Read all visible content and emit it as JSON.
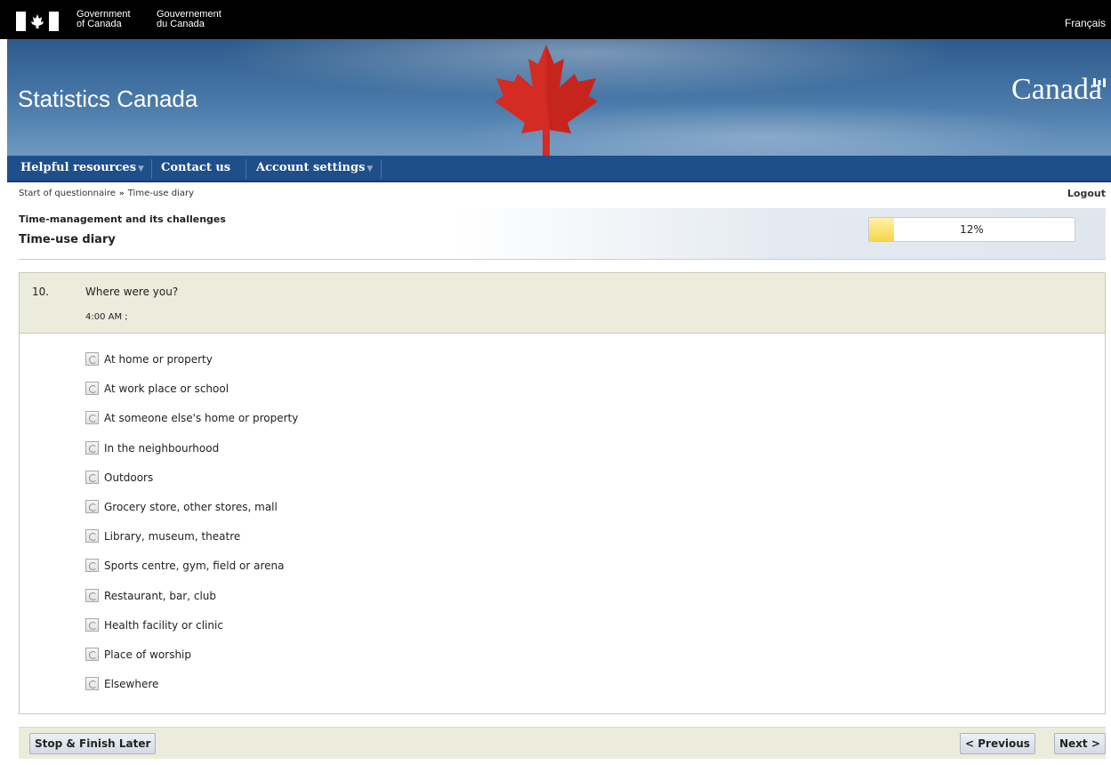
{
  "gov_bar": {
    "english_line1": "Government",
    "english_line2": "of Canada",
    "french_line1": "Gouvernement",
    "french_line2": "du Canada",
    "language_link": "Français"
  },
  "banner": {
    "site_title": "Statistics Canada",
    "wordmark": "Canada"
  },
  "nav": {
    "items": [
      {
        "label": "Helpful resources",
        "has_menu": true
      },
      {
        "label": "Contact us",
        "has_menu": false
      },
      {
        "label": "Account settings",
        "has_menu": true
      }
    ]
  },
  "breadcrumb": {
    "items": [
      "Start of questionnaire",
      "Time-use diary"
    ],
    "separator": "»"
  },
  "logout_label": "Logout",
  "section": {
    "subtitle": "Time-management and its challenges",
    "title": "Time-use diary"
  },
  "progress": {
    "percent": 12,
    "label": "12%"
  },
  "question": {
    "number": "10.",
    "text": "Where were you?",
    "time": "4:00 AM ;",
    "options": [
      "At home or property",
      "At work place or school",
      "At someone else's home or property",
      "In the neighbourhood",
      "Outdoors",
      "Grocery store, other stores, mall",
      "Library, museum, theatre",
      "Sports centre, gym, field or arena",
      "Restaurant, bar, club",
      "Health facility or clinic",
      "Place of worship",
      "Elsewhere"
    ]
  },
  "footer": {
    "stop_label": "Stop & Finish Later",
    "previous_label": "< Previous",
    "next_label": "Next >"
  },
  "colors": {
    "nav_bg": "#1f4f8a",
    "banner_blue": "#3c6a9a",
    "question_header_bg": "#ececdd",
    "progress_fill": "#f7d64a",
    "leaf_red": "#d42b22"
  }
}
